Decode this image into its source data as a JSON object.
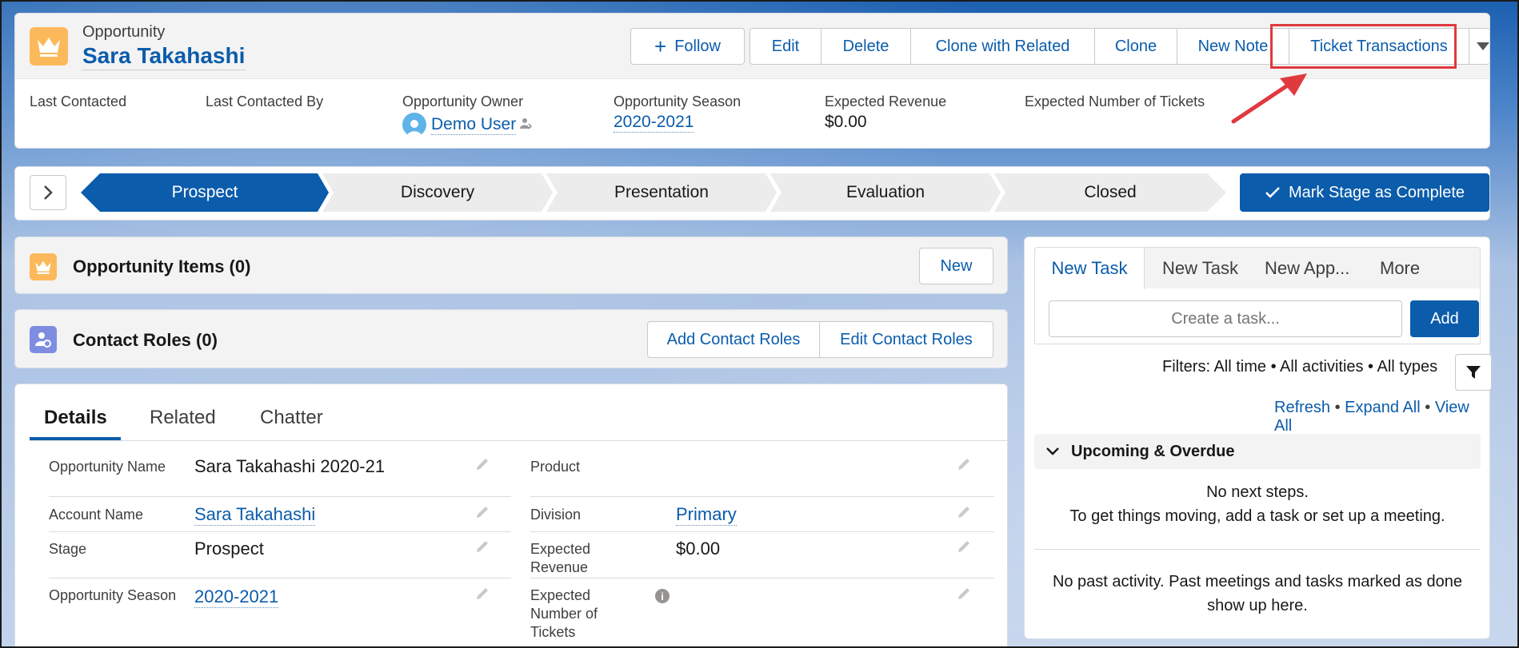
{
  "header": {
    "object_type": "Opportunity",
    "record_name": "Sara Takahashi",
    "actions": {
      "follow": "Follow",
      "edit": "Edit",
      "delete": "Delete",
      "clone_related": "Clone with Related",
      "clone": "Clone",
      "new_note": "New Note",
      "ticket_transactions": "Ticket Transactions"
    },
    "fields": {
      "last_contacted": "Last Contacted",
      "last_contacted_by": "Last Contacted By",
      "owner_label": "Opportunity Owner",
      "owner_value": "Demo User",
      "season_label": "Opportunity Season",
      "season_value": "2020-2021",
      "revenue_label": "Expected Revenue",
      "revenue_value": "$0.00",
      "tickets_label": "Expected Number of Tickets"
    }
  },
  "path": {
    "steps": [
      "Prospect",
      "Discovery",
      "Presentation",
      "Evaluation",
      "Closed"
    ],
    "active_index": 0,
    "mark_complete": "Mark Stage as Complete"
  },
  "opportunity_items": {
    "title": "Opportunity Items (0)",
    "new": "New"
  },
  "contact_roles": {
    "title": "Contact Roles (0)",
    "add": "Add Contact Roles",
    "edit": "Edit Contact Roles"
  },
  "details": {
    "tabs": [
      "Details",
      "Related",
      "Chatter"
    ],
    "fields": {
      "opp_name_label": "Opportunity Name",
      "opp_name_value": "Sara Takahashi 2020-21",
      "account_label": "Account Name",
      "account_value": "Sara Takahashi",
      "stage_label": "Stage",
      "stage_value": "Prospect",
      "season_label": "Opportunity Season",
      "season_value": "2020-2021",
      "product_label": "Product",
      "division_label": "Division",
      "division_value": "Primary",
      "exp_rev_label": "Expected Revenue",
      "exp_rev_value": "$0.00",
      "exp_tickets_label": "Expected Number of Tickets"
    }
  },
  "activity": {
    "tabs": [
      "New Task",
      "New Task",
      "New App...",
      "More"
    ],
    "task_placeholder": "Create a task...",
    "add": "Add",
    "filters": "Filters: All time • All activities • All types",
    "refresh": "Refresh",
    "sep": "•",
    "expand_all": "Expand All",
    "view_all": "View All",
    "upcoming": "Upcoming & Overdue",
    "no_next_1": "No next steps.",
    "no_next_2": "To get things moving, add a task or set up a meeting.",
    "no_past": "No past activity. Past meetings and tasks marked as done show up here."
  }
}
